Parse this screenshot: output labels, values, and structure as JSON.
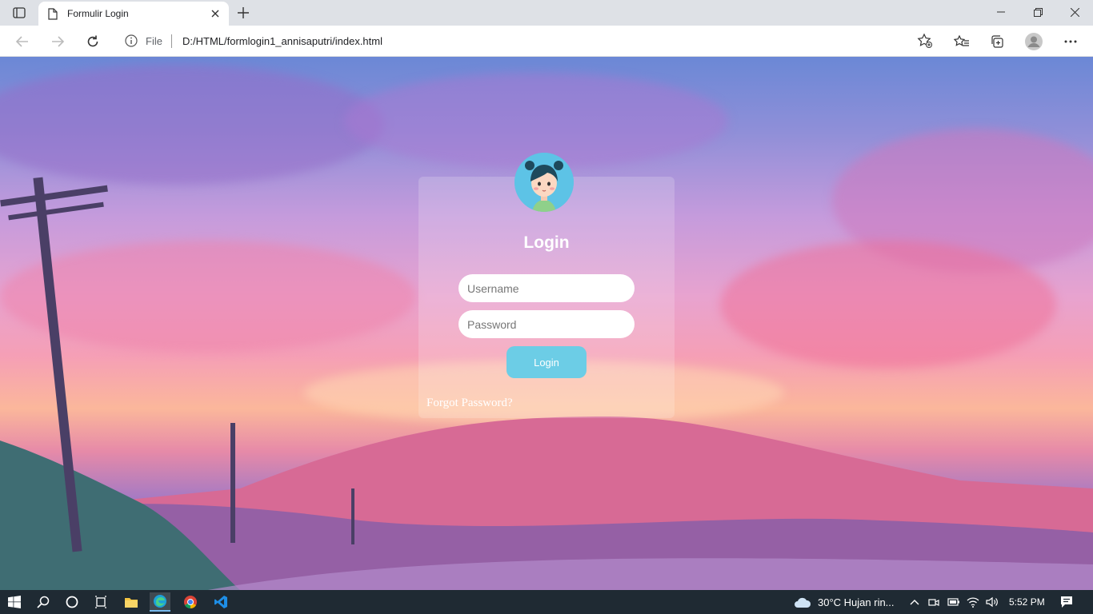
{
  "browser": {
    "tab_title": "Formulir Login",
    "scheme_label": "File",
    "url": "D:/HTML/formlogin1_annisaputri/index.html"
  },
  "login": {
    "title": "Login",
    "username_placeholder": "Username",
    "password_placeholder": "Password",
    "button_label": "Login",
    "forgot_label": "Forgot Password?"
  },
  "taskbar": {
    "weather": "30°C  Hujan rin...",
    "time": "5:52 PM"
  },
  "colors": {
    "accent_button": "#6ccde6",
    "avatar_bg": "#5dc3e6",
    "taskbar_bg": "#1f2a33"
  }
}
